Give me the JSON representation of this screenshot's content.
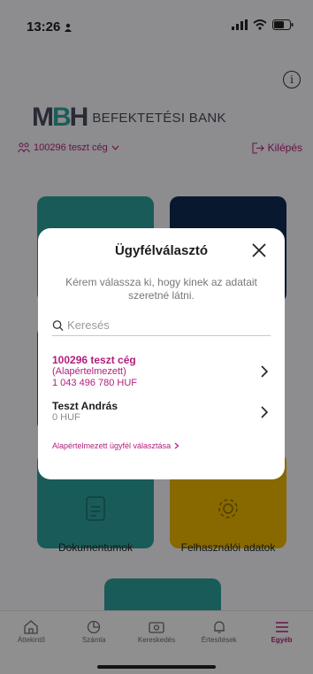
{
  "status_bar": {
    "time": "13:26"
  },
  "brand": {
    "logo_text_left": "M",
    "logo_text_mid": "B",
    "logo_text_right": "H",
    "name": "BEFEKTETÉSI BANK"
  },
  "header": {
    "client_selector": "100296 teszt cég",
    "logout_label": "Kilépés"
  },
  "tiles": {
    "docs_caption": "Dokumentumok",
    "user_caption": "Felhasználói adatok"
  },
  "bottom_nav": {
    "items": [
      {
        "label": "Áttekintő",
        "icon": "home-icon"
      },
      {
        "label": "Számla",
        "icon": "account-icon"
      },
      {
        "label": "Kereskedés",
        "icon": "trading-icon"
      },
      {
        "label": "Értesítések",
        "icon": "bell-icon"
      },
      {
        "label": "Egyéb",
        "icon": "menu-icon"
      }
    ],
    "active": "Egyéb"
  },
  "modal": {
    "title": "Ügyfélválasztó",
    "description": "Kérem válassza ki, hogy kinek az adatait szeretné látni.",
    "search_placeholder": "Keresés",
    "clients": [
      {
        "name": "100296 teszt cég",
        "tag": "(Alapértelmezett)",
        "balance": "1 043 496 780 HUF",
        "selected": true
      },
      {
        "name": "Teszt András",
        "balance": "0 HUF",
        "selected": false
      }
    ],
    "default_link": "Alapértelmezett ügyfél választása"
  },
  "colors": {
    "accent": "#b01f7c",
    "teal": "#2b9d98",
    "navy": "#0f2a52",
    "yellow": "#e8b600"
  }
}
